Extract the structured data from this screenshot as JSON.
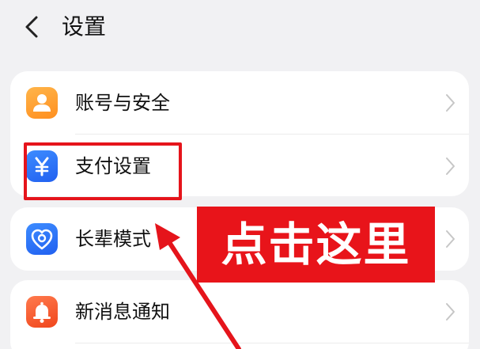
{
  "header": {
    "title": "设置",
    "back_icon": "chevron-left-icon"
  },
  "settings_groups": [
    {
      "items": [
        {
          "label": "账号与安全",
          "icon": "user-icon",
          "icon_color": "#ff9a2e"
        },
        {
          "label": "支付设置",
          "icon": "yuan-icon",
          "icon_color": "#2e6ff6"
        }
      ]
    },
    {
      "items": [
        {
          "label": "长辈模式",
          "icon": "heart-shield-icon",
          "icon_color": "#2e6ff6"
        }
      ]
    },
    {
      "items": [
        {
          "label": "新消息通知",
          "icon": "bell-icon",
          "icon_color": "#f5532a"
        }
      ]
    }
  ],
  "annotation": {
    "banner_text": "点击这里",
    "color": "#e8141a"
  }
}
